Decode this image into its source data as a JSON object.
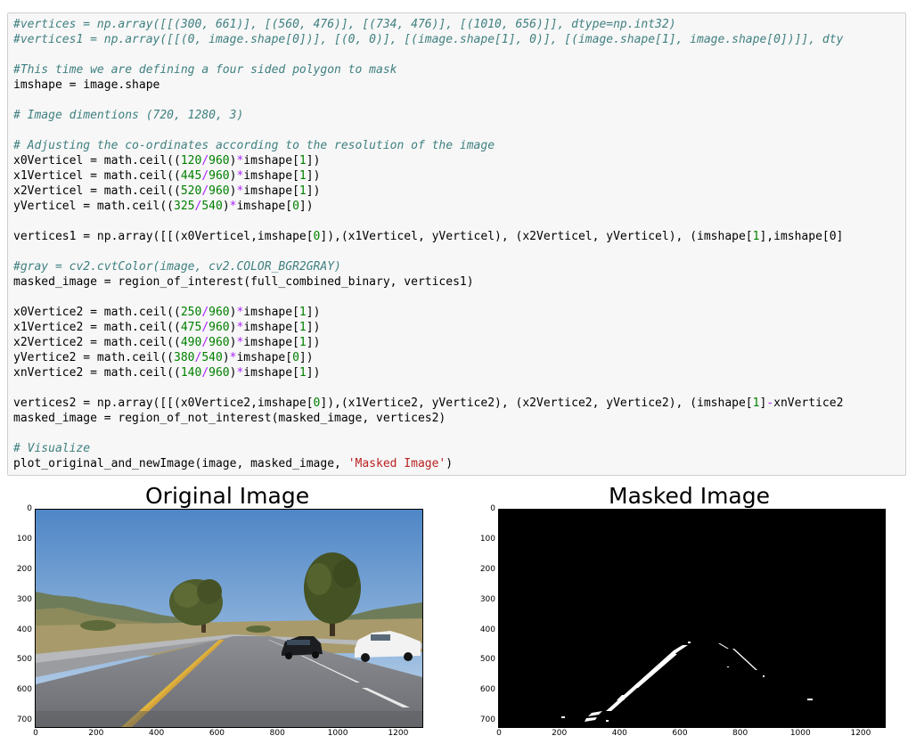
{
  "cell": {
    "lines": [
      [
        [
          "com",
          "#vertices = np.array([[(300, 661)], [(560, 476)], [(734, 476)], [(1010, 656)]], dtype=np.int32)"
        ]
      ],
      [
        [
          "com",
          "#vertices1 = np.array([[(0, image.shape[0])], [(0, 0)], [(image.shape[1], 0)], [(image.shape[1], image.shape[0])]], dty"
        ]
      ],
      [
        [
          "txt",
          ""
        ]
      ],
      [
        [
          "com",
          "#This time we are defining a four sided polygon to mask"
        ]
      ],
      [
        [
          "txt",
          "imshape = image.shape"
        ]
      ],
      [
        [
          "txt",
          ""
        ]
      ],
      [
        [
          "com",
          "# Image dimentions (720, 1280, 3)"
        ]
      ],
      [
        [
          "txt",
          ""
        ]
      ],
      [
        [
          "com",
          "# Adjusting the co-ordinates according to the resolution of the image"
        ]
      ],
      [
        [
          "txt",
          "x0Verticel = math.ceil(("
        ],
        [
          "num",
          "120"
        ],
        [
          "op",
          "/"
        ],
        [
          "num",
          "960"
        ],
        [
          "txt",
          ")"
        ],
        [
          "op",
          "*"
        ],
        [
          "txt",
          "imshape["
        ],
        [
          "num",
          "1"
        ],
        [
          "txt",
          "])"
        ]
      ],
      [
        [
          "txt",
          "x1Verticel = math.ceil(("
        ],
        [
          "num",
          "445"
        ],
        [
          "op",
          "/"
        ],
        [
          "num",
          "960"
        ],
        [
          "txt",
          ")"
        ],
        [
          "op",
          "*"
        ],
        [
          "txt",
          "imshape["
        ],
        [
          "num",
          "1"
        ],
        [
          "txt",
          "])"
        ]
      ],
      [
        [
          "txt",
          "x2Verticel = math.ceil(("
        ],
        [
          "num",
          "520"
        ],
        [
          "op",
          "/"
        ],
        [
          "num",
          "960"
        ],
        [
          "txt",
          ")"
        ],
        [
          "op",
          "*"
        ],
        [
          "txt",
          "imshape["
        ],
        [
          "num",
          "1"
        ],
        [
          "txt",
          "])"
        ]
      ],
      [
        [
          "txt",
          "yVerticel = math.ceil(("
        ],
        [
          "num",
          "325"
        ],
        [
          "op",
          "/"
        ],
        [
          "num",
          "540"
        ],
        [
          "txt",
          ")"
        ],
        [
          "op",
          "*"
        ],
        [
          "txt",
          "imshape["
        ],
        [
          "num",
          "0"
        ],
        [
          "txt",
          "])"
        ]
      ],
      [
        [
          "txt",
          ""
        ]
      ],
      [
        [
          "txt",
          "vertices1 = np.array([[(x0Verticel,imshape["
        ],
        [
          "num",
          "0"
        ],
        [
          "txt",
          "]),(x1Verticel, yVerticel), (x2Verticel, yVerticel), (imshape["
        ],
        [
          "num",
          "1"
        ],
        [
          "txt",
          "],imshape[0]"
        ]
      ],
      [
        [
          "txt",
          ""
        ]
      ],
      [
        [
          "com",
          "#gray = cv2.cvtColor(image, cv2.COLOR_BGR2GRAY)"
        ]
      ],
      [
        [
          "txt",
          "masked_image = region_of_interest(full_combined_binary, vertices1)"
        ]
      ],
      [
        [
          "txt",
          ""
        ]
      ],
      [
        [
          "txt",
          "x0Vertice2 = math.ceil(("
        ],
        [
          "num",
          "250"
        ],
        [
          "op",
          "/"
        ],
        [
          "num",
          "960"
        ],
        [
          "txt",
          ")"
        ],
        [
          "op",
          "*"
        ],
        [
          "txt",
          "imshape["
        ],
        [
          "num",
          "1"
        ],
        [
          "txt",
          "])"
        ]
      ],
      [
        [
          "txt",
          "x1Vertice2 = math.ceil(("
        ],
        [
          "num",
          "475"
        ],
        [
          "op",
          "/"
        ],
        [
          "num",
          "960"
        ],
        [
          "txt",
          ")"
        ],
        [
          "op",
          "*"
        ],
        [
          "txt",
          "imshape["
        ],
        [
          "num",
          "1"
        ],
        [
          "txt",
          "])"
        ]
      ],
      [
        [
          "txt",
          "x2Vertice2 = math.ceil(("
        ],
        [
          "num",
          "490"
        ],
        [
          "op",
          "/"
        ],
        [
          "num",
          "960"
        ],
        [
          "txt",
          ")"
        ],
        [
          "op",
          "*"
        ],
        [
          "txt",
          "imshape["
        ],
        [
          "num",
          "1"
        ],
        [
          "txt",
          "])"
        ]
      ],
      [
        [
          "txt",
          "yVertice2 = math.ceil(("
        ],
        [
          "num",
          "380"
        ],
        [
          "op",
          "/"
        ],
        [
          "num",
          "540"
        ],
        [
          "txt",
          ")"
        ],
        [
          "op",
          "*"
        ],
        [
          "txt",
          "imshape["
        ],
        [
          "num",
          "0"
        ],
        [
          "txt",
          "])"
        ]
      ],
      [
        [
          "txt",
          "xnVertice2 = math.ceil(("
        ],
        [
          "num",
          "140"
        ],
        [
          "op",
          "/"
        ],
        [
          "num",
          "960"
        ],
        [
          "txt",
          ")"
        ],
        [
          "op",
          "*"
        ],
        [
          "txt",
          "imshape["
        ],
        [
          "num",
          "1"
        ],
        [
          "txt",
          "])"
        ]
      ],
      [
        [
          "txt",
          ""
        ]
      ],
      [
        [
          "txt",
          "vertices2 = np.array([[(x0Vertice2,imshape["
        ],
        [
          "num",
          "0"
        ],
        [
          "txt",
          "]),(x1Vertice2, yVertice2), (x2Vertice2, yVertice2), (imshape["
        ],
        [
          "num",
          "1"
        ],
        [
          "txt",
          "]"
        ],
        [
          "op",
          "-"
        ],
        [
          "txt",
          "xnVertice2"
        ]
      ],
      [
        [
          "txt",
          "masked_image = region_of_not_interest(masked_image, vertices2)"
        ]
      ],
      [
        [
          "txt",
          ""
        ]
      ],
      [
        [
          "com",
          "# Visualize"
        ]
      ],
      [
        [
          "txt",
          "plot_original_and_newImage(image, masked_image, "
        ],
        [
          "str",
          "'Masked Image'"
        ],
        [
          "txt",
          ")"
        ]
      ]
    ]
  },
  "plots": {
    "original": {
      "title": "Original Image",
      "y_ticks": [
        "0",
        "100",
        "200",
        "300",
        "400",
        "500",
        "600",
        "700"
      ],
      "x_ticks": [
        "0",
        "200",
        "400",
        "600",
        "800",
        "1000",
        "1200"
      ]
    },
    "masked": {
      "title": "Masked Image",
      "y_ticks": [
        "0",
        "100",
        "200",
        "300",
        "400",
        "500",
        "600",
        "700"
      ],
      "x_ticks": [
        "0",
        "200",
        "400",
        "600",
        "800",
        "1000",
        "1200"
      ]
    }
  },
  "colors": {
    "comment": "#408080",
    "number": "#008000",
    "operator": "#aa22ff",
    "string": "#ba2121",
    "cell_bg": "#f7f7f7",
    "cell_border": "#cfcfcf"
  }
}
